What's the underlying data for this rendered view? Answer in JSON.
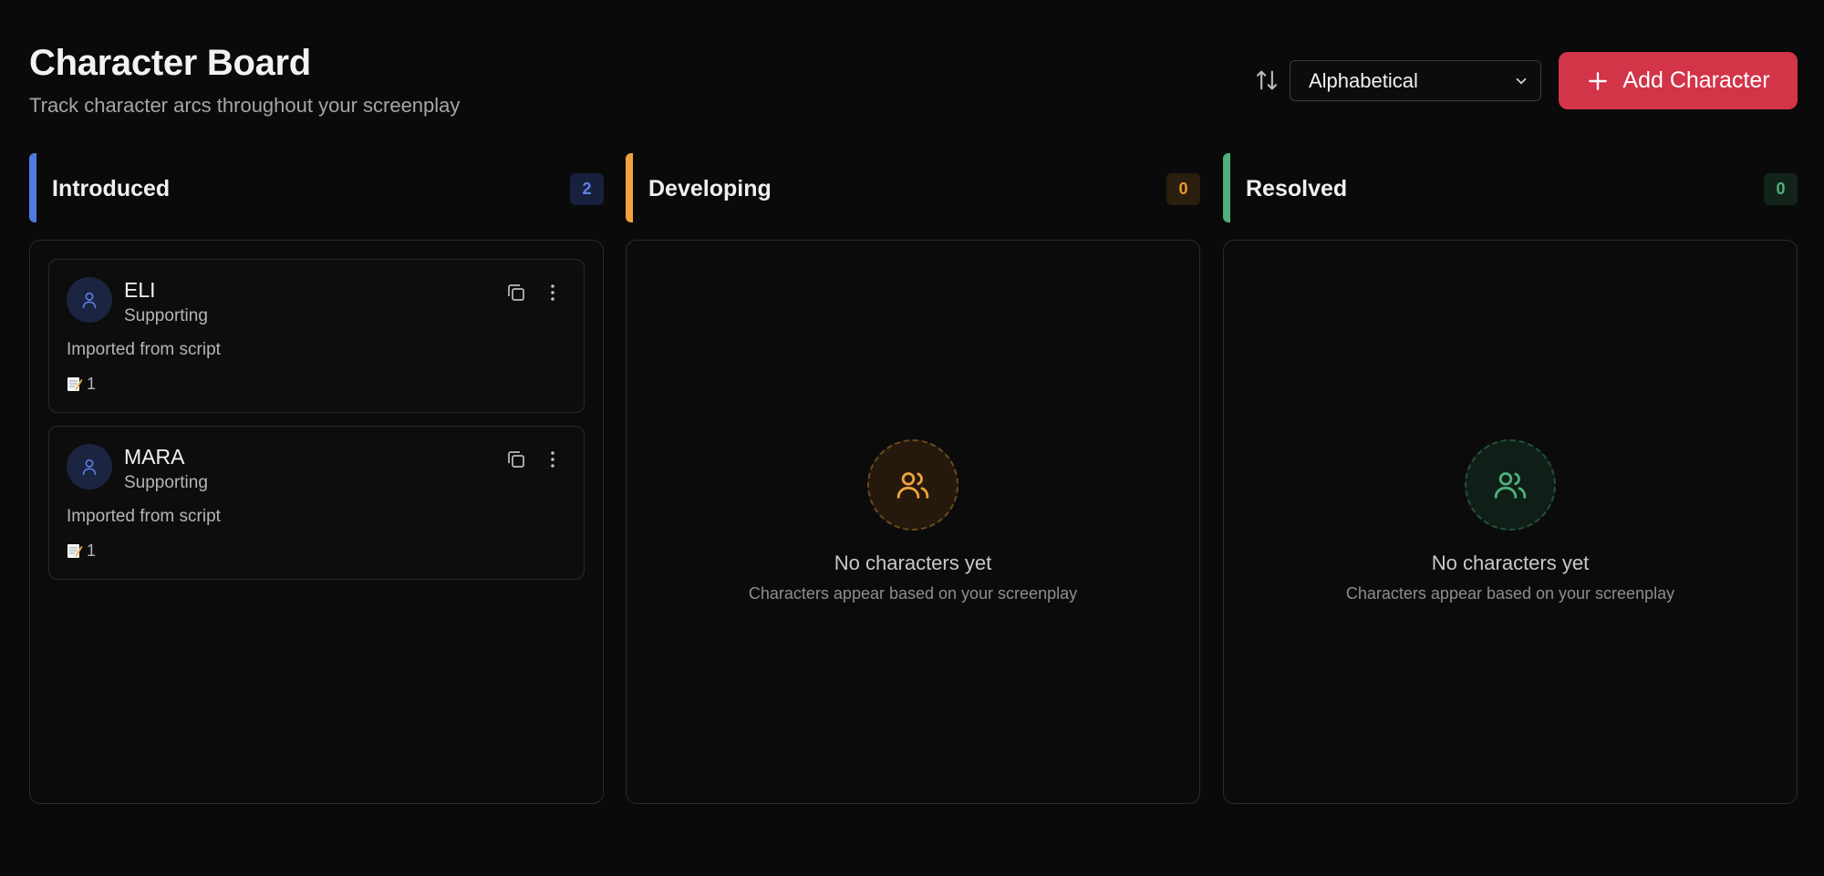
{
  "header": {
    "title": "Character Board",
    "subtitle": "Track character arcs throughout your screenplay"
  },
  "toolbar": {
    "sort_value": "Alphabetical",
    "add_label": "Add Character"
  },
  "columns": [
    {
      "title": "Introduced",
      "count": "2",
      "accent": "#4f7be0"
    },
    {
      "title": "Developing",
      "count": "0",
      "accent": "#f0a23a"
    },
    {
      "title": "Resolved",
      "count": "0",
      "accent": "#4fb07a"
    }
  ],
  "characters": [
    {
      "name": "ELI",
      "role": "Supporting",
      "note": "Imported from script",
      "scenes": "1"
    },
    {
      "name": "MARA",
      "role": "Supporting",
      "note": "Imported from script",
      "scenes": "1"
    }
  ],
  "empty_state": {
    "title": "No characters yet",
    "subtitle": "Characters appear based on your screenplay"
  },
  "colors": {
    "background": "#0a0a0a",
    "primary_button": "#d23448",
    "introduced": "#4f7be0",
    "developing": "#f0a23a",
    "resolved": "#4fb07a"
  },
  "icons": [
    "sort-icon",
    "chevron-down-icon",
    "plus-icon",
    "user-icon",
    "copy-icon",
    "more-vertical-icon",
    "memo-icon",
    "users-icon"
  ]
}
